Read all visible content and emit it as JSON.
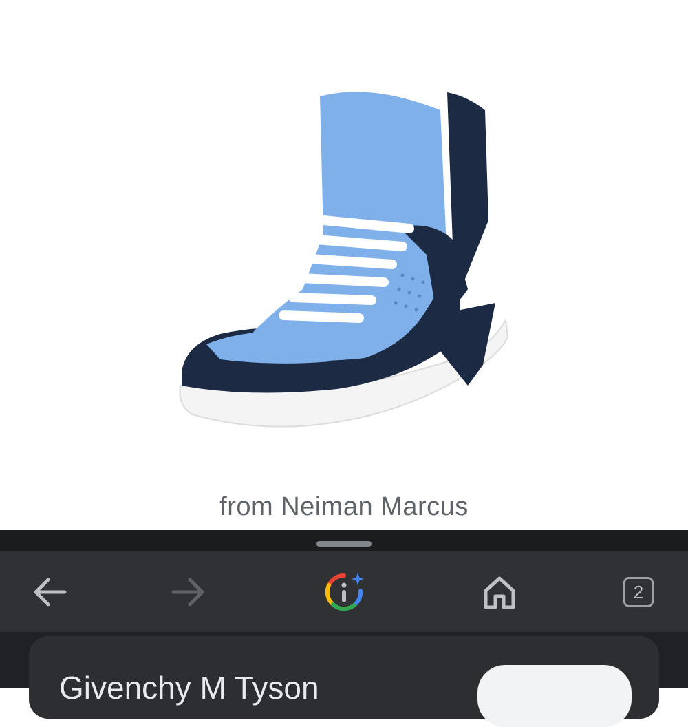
{
  "product": {
    "source_caption": "from Neiman Marcus",
    "image_colors": {
      "upper": "#7fb0ea",
      "trim": "#1d2a44",
      "sole": "#f4f4f4",
      "laces": "#ffffff"
    }
  },
  "toolbar": {
    "back_icon": "arrow-left-icon",
    "forward_icon": "arrow-right-icon",
    "lens_icon": "google-lens-icon",
    "home_icon": "home-icon",
    "tab_count": "2"
  },
  "result": {
    "title": "Givenchy M Tyson"
  },
  "colors": {
    "sheet_bg": "#202124",
    "toolbar_bg": "#303134",
    "icon_active": "#bdc1c6",
    "icon_disabled": "#5f6368"
  }
}
